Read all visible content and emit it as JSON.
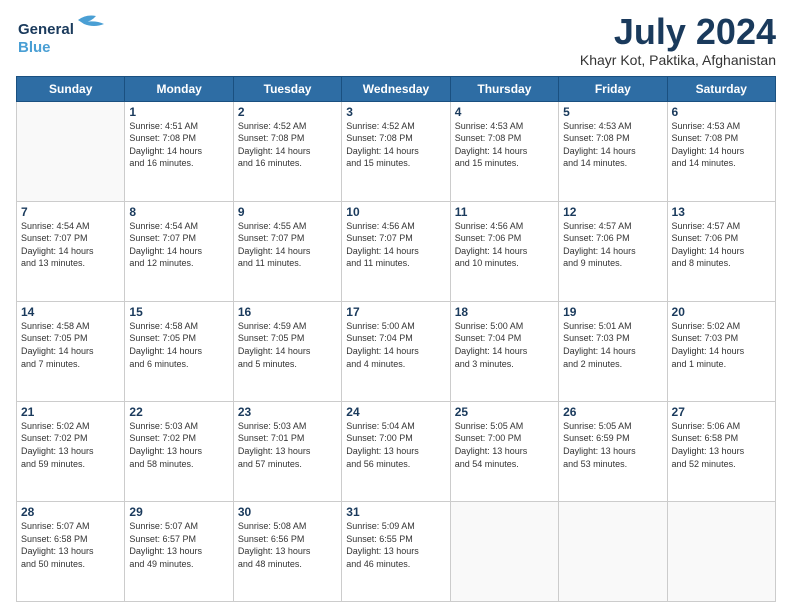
{
  "header": {
    "logo_line1": "General",
    "logo_line2": "Blue",
    "month": "July 2024",
    "location": "Khayr Kot, Paktika, Afghanistan"
  },
  "weekdays": [
    "Sunday",
    "Monday",
    "Tuesday",
    "Wednesday",
    "Thursday",
    "Friday",
    "Saturday"
  ],
  "weeks": [
    [
      {
        "day": "",
        "info": ""
      },
      {
        "day": "1",
        "info": "Sunrise: 4:51 AM\nSunset: 7:08 PM\nDaylight: 14 hours\nand 16 minutes."
      },
      {
        "day": "2",
        "info": "Sunrise: 4:52 AM\nSunset: 7:08 PM\nDaylight: 14 hours\nand 16 minutes."
      },
      {
        "day": "3",
        "info": "Sunrise: 4:52 AM\nSunset: 7:08 PM\nDaylight: 14 hours\nand 15 minutes."
      },
      {
        "day": "4",
        "info": "Sunrise: 4:53 AM\nSunset: 7:08 PM\nDaylight: 14 hours\nand 15 minutes."
      },
      {
        "day": "5",
        "info": "Sunrise: 4:53 AM\nSunset: 7:08 PM\nDaylight: 14 hours\nand 14 minutes."
      },
      {
        "day": "6",
        "info": "Sunrise: 4:53 AM\nSunset: 7:08 PM\nDaylight: 14 hours\nand 14 minutes."
      }
    ],
    [
      {
        "day": "7",
        "info": "Sunrise: 4:54 AM\nSunset: 7:07 PM\nDaylight: 14 hours\nand 13 minutes."
      },
      {
        "day": "8",
        "info": "Sunrise: 4:54 AM\nSunset: 7:07 PM\nDaylight: 14 hours\nand 12 minutes."
      },
      {
        "day": "9",
        "info": "Sunrise: 4:55 AM\nSunset: 7:07 PM\nDaylight: 14 hours\nand 11 minutes."
      },
      {
        "day": "10",
        "info": "Sunrise: 4:56 AM\nSunset: 7:07 PM\nDaylight: 14 hours\nand 11 minutes."
      },
      {
        "day": "11",
        "info": "Sunrise: 4:56 AM\nSunset: 7:06 PM\nDaylight: 14 hours\nand 10 minutes."
      },
      {
        "day": "12",
        "info": "Sunrise: 4:57 AM\nSunset: 7:06 PM\nDaylight: 14 hours\nand 9 minutes."
      },
      {
        "day": "13",
        "info": "Sunrise: 4:57 AM\nSunset: 7:06 PM\nDaylight: 14 hours\nand 8 minutes."
      }
    ],
    [
      {
        "day": "14",
        "info": "Sunrise: 4:58 AM\nSunset: 7:05 PM\nDaylight: 14 hours\nand 7 minutes."
      },
      {
        "day": "15",
        "info": "Sunrise: 4:58 AM\nSunset: 7:05 PM\nDaylight: 14 hours\nand 6 minutes."
      },
      {
        "day": "16",
        "info": "Sunrise: 4:59 AM\nSunset: 7:05 PM\nDaylight: 14 hours\nand 5 minutes."
      },
      {
        "day": "17",
        "info": "Sunrise: 5:00 AM\nSunset: 7:04 PM\nDaylight: 14 hours\nand 4 minutes."
      },
      {
        "day": "18",
        "info": "Sunrise: 5:00 AM\nSunset: 7:04 PM\nDaylight: 14 hours\nand 3 minutes."
      },
      {
        "day": "19",
        "info": "Sunrise: 5:01 AM\nSunset: 7:03 PM\nDaylight: 14 hours\nand 2 minutes."
      },
      {
        "day": "20",
        "info": "Sunrise: 5:02 AM\nSunset: 7:03 PM\nDaylight: 14 hours\nand 1 minute."
      }
    ],
    [
      {
        "day": "21",
        "info": "Sunrise: 5:02 AM\nSunset: 7:02 PM\nDaylight: 13 hours\nand 59 minutes."
      },
      {
        "day": "22",
        "info": "Sunrise: 5:03 AM\nSunset: 7:02 PM\nDaylight: 13 hours\nand 58 minutes."
      },
      {
        "day": "23",
        "info": "Sunrise: 5:03 AM\nSunset: 7:01 PM\nDaylight: 13 hours\nand 57 minutes."
      },
      {
        "day": "24",
        "info": "Sunrise: 5:04 AM\nSunset: 7:00 PM\nDaylight: 13 hours\nand 56 minutes."
      },
      {
        "day": "25",
        "info": "Sunrise: 5:05 AM\nSunset: 7:00 PM\nDaylight: 13 hours\nand 54 minutes."
      },
      {
        "day": "26",
        "info": "Sunrise: 5:05 AM\nSunset: 6:59 PM\nDaylight: 13 hours\nand 53 minutes."
      },
      {
        "day": "27",
        "info": "Sunrise: 5:06 AM\nSunset: 6:58 PM\nDaylight: 13 hours\nand 52 minutes."
      }
    ],
    [
      {
        "day": "28",
        "info": "Sunrise: 5:07 AM\nSunset: 6:58 PM\nDaylight: 13 hours\nand 50 minutes."
      },
      {
        "day": "29",
        "info": "Sunrise: 5:07 AM\nSunset: 6:57 PM\nDaylight: 13 hours\nand 49 minutes."
      },
      {
        "day": "30",
        "info": "Sunrise: 5:08 AM\nSunset: 6:56 PM\nDaylight: 13 hours\nand 48 minutes."
      },
      {
        "day": "31",
        "info": "Sunrise: 5:09 AM\nSunset: 6:55 PM\nDaylight: 13 hours\nand 46 minutes."
      },
      {
        "day": "",
        "info": ""
      },
      {
        "day": "",
        "info": ""
      },
      {
        "day": "",
        "info": ""
      }
    ]
  ]
}
